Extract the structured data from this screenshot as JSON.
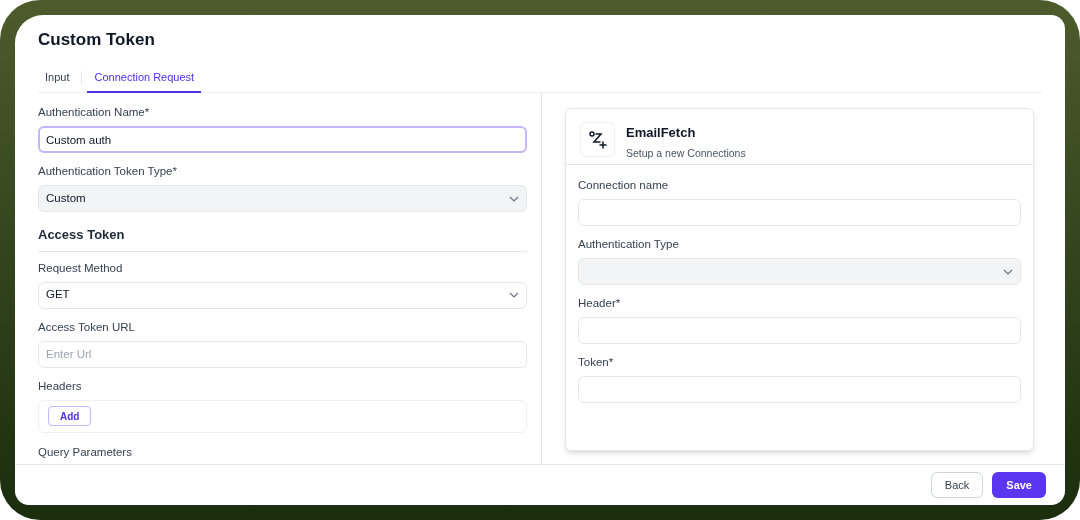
{
  "title": "Custom Token",
  "tabs": [
    {
      "label": "Input",
      "selected": false
    },
    {
      "label": "Connection Request",
      "selected": true
    }
  ],
  "form": [
    {
      "kind": "input",
      "label": "Authentication Name*",
      "value": "Custom auth",
      "focused": true
    },
    {
      "kind": "select",
      "label": "Authentication Token Type*",
      "value": "Custom",
      "disabled": true
    },
    {
      "kind": "section",
      "label": "Access Token"
    },
    {
      "kind": "select",
      "label": "Request Method",
      "value": "GET",
      "disabled": false
    },
    {
      "kind": "input",
      "label": "Access Token URL",
      "placeholder": "Enter Url",
      "focused": false
    },
    {
      "kind": "list",
      "label": "Headers",
      "button": "Add"
    },
    {
      "kind": "label",
      "label": "Query Parameters"
    }
  ],
  "connection_card": {
    "title": "EmailFetch",
    "subtitle": "Setup a new Connections",
    "fields": [
      {
        "kind": "input",
        "label": "Connection name",
        "focused": false
      },
      {
        "kind": "select",
        "label": "Authentication Type",
        "disabled": true
      },
      {
        "kind": "input",
        "label": "Header*",
        "focused": false
      },
      {
        "kind": "input",
        "label": "Token*",
        "focused": false
      }
    ]
  },
  "footer": {
    "buttons": [
      {
        "label": "Back",
        "kind": "secondary"
      },
      {
        "label": "Save",
        "kind": "primary"
      }
    ]
  }
}
